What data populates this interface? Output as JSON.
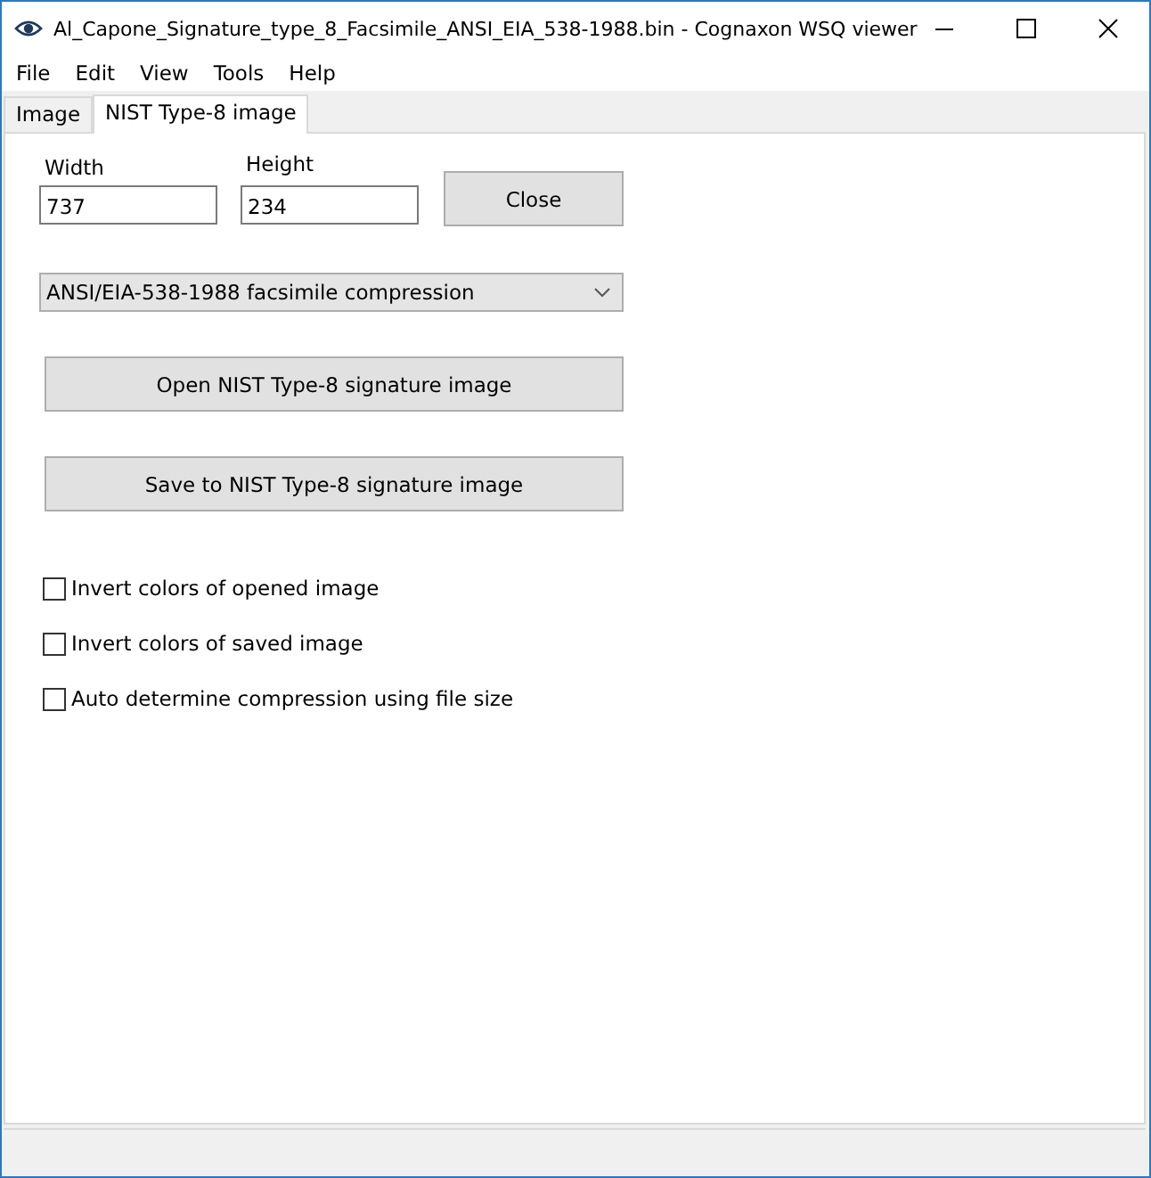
{
  "window": {
    "title": "Al_Capone_Signature_type_8_Facsimile_ANSI_EIA_538-1988.bin - Cognaxon WSQ viewer"
  },
  "menu": [
    "File",
    "Edit",
    "View",
    "Tools",
    "Help"
  ],
  "tabs": [
    {
      "label": "Image",
      "selected": false
    },
    {
      "label": "NIST Type-8 image",
      "selected": true
    }
  ],
  "width_field": {
    "label": "Width",
    "value": "737"
  },
  "height_field": {
    "label": "Height",
    "value": "234"
  },
  "close_button": "Close",
  "compression_dropdown": {
    "value": "ANSI/EIA-538-1988 facsimile compression"
  },
  "action_buttons": [
    "Open NIST Type-8 signature image",
    "Save to NIST Type-8 signature image"
  ],
  "checkboxes": [
    {
      "label": "Invert colors of opened image",
      "checked": false
    },
    {
      "label": "Invert colors of saved image",
      "checked": false
    },
    {
      "label": "Auto determine compression using file size",
      "checked": false
    }
  ]
}
